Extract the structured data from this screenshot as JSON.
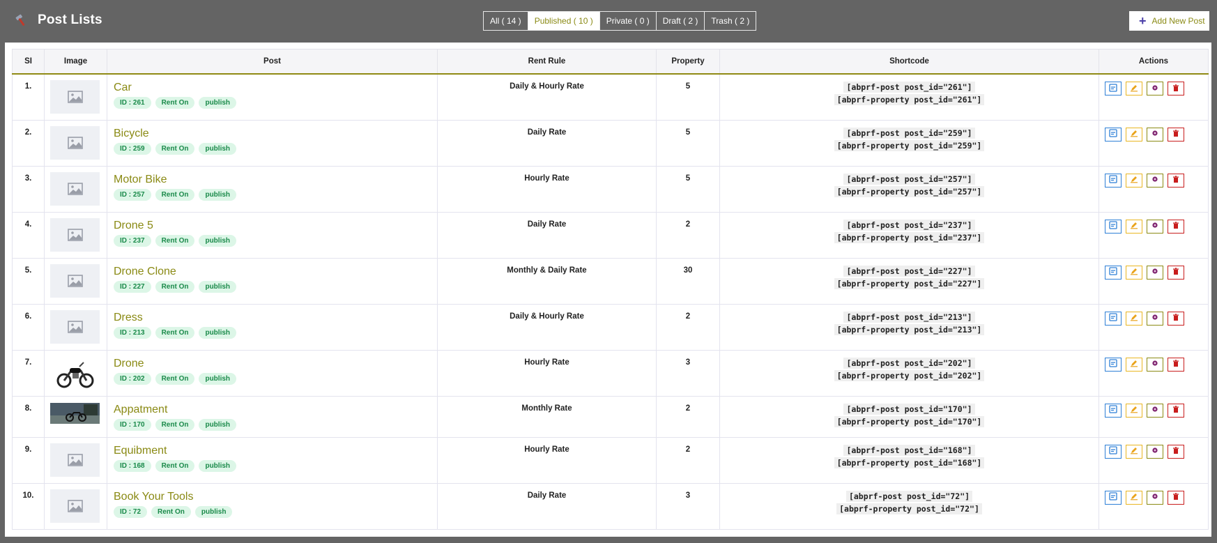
{
  "header": {
    "title": "Post Lists",
    "filters": [
      {
        "label": "All ( 14 )",
        "active": false
      },
      {
        "label": "Published ( 10 )",
        "active": true
      },
      {
        "label": "Private ( 0 )",
        "active": false
      },
      {
        "label": "Draft ( 2 )",
        "active": false
      },
      {
        "label": "Trash ( 2 )",
        "active": false
      }
    ],
    "add_label": "Add New Post"
  },
  "table": {
    "columns": [
      "SI",
      "Image",
      "Post",
      "Rent Rule",
      "Property",
      "Shortcode",
      "Actions"
    ],
    "rows": [
      {
        "si": "1.",
        "image": "placeholder",
        "title": "Car",
        "id_tag": "ID : 261",
        "rent_tag": "Rent On",
        "status_tag": "publish",
        "rule": "Daily & Hourly Rate",
        "property": "5",
        "sc1": "[abprf-post post_id=\"261\"]",
        "sc2": "[abprf-property post_id=\"261\"]"
      },
      {
        "si": "2.",
        "image": "placeholder",
        "title": "Bicycle",
        "id_tag": "ID : 259",
        "rent_tag": "Rent On",
        "status_tag": "publish",
        "rule": "Daily Rate",
        "property": "5",
        "sc1": "[abprf-post post_id=\"259\"]",
        "sc2": "[abprf-property post_id=\"259\"]"
      },
      {
        "si": "3.",
        "image": "placeholder",
        "title": "Motor Bike",
        "id_tag": "ID : 257",
        "rent_tag": "Rent On",
        "status_tag": "publish",
        "rule": "Hourly Rate",
        "property": "5",
        "sc1": "[abprf-post post_id=\"257\"]",
        "sc2": "[abprf-property post_id=\"257\"]"
      },
      {
        "si": "4.",
        "image": "placeholder",
        "title": "Drone 5",
        "id_tag": "ID : 237",
        "rent_tag": "Rent On",
        "status_tag": "publish",
        "rule": "Daily Rate",
        "property": "2",
        "sc1": "[abprf-post post_id=\"237\"]",
        "sc2": "[abprf-property post_id=\"237\"]"
      },
      {
        "si": "5.",
        "image": "placeholder",
        "title": "Drone Clone",
        "id_tag": "ID : 227",
        "rent_tag": "Rent On",
        "status_tag": "publish",
        "rule": "Monthly & Daily Rate",
        "property": "30",
        "sc1": "[abprf-post post_id=\"227\"]",
        "sc2": "[abprf-property post_id=\"227\"]"
      },
      {
        "si": "6.",
        "image": "placeholder",
        "title": "Dress",
        "id_tag": "ID : 213",
        "rent_tag": "Rent On",
        "status_tag": "publish",
        "rule": "Daily & Hourly Rate",
        "property": "2",
        "sc1": "[abprf-post post_id=\"213\"]",
        "sc2": "[abprf-property post_id=\"213\"]"
      },
      {
        "si": "7.",
        "image": "motorbike-photo",
        "title": "Drone",
        "id_tag": "ID : 202",
        "rent_tag": "Rent On",
        "status_tag": "publish",
        "rule": "Hourly Rate",
        "property": "3",
        "sc1": "[abprf-post post_id=\"202\"]",
        "sc2": "[abprf-property post_id=\"202\"]"
      },
      {
        "si": "8.",
        "image": "motorbike-landscape-photo",
        "title": "Appatment",
        "id_tag": "ID : 170",
        "rent_tag": "Rent On",
        "status_tag": "publish",
        "rule": "Monthly Rate",
        "property": "2",
        "sc1": "[abprf-post post_id=\"170\"]",
        "sc2": "[abprf-property post_id=\"170\"]"
      },
      {
        "si": "9.",
        "image": "placeholder",
        "title": "Equibment",
        "id_tag": "ID : 168",
        "rent_tag": "Rent On",
        "status_tag": "publish",
        "rule": "Hourly Rate",
        "property": "2",
        "sc1": "[abprf-post post_id=\"168\"]",
        "sc2": "[abprf-property post_id=\"168\"]"
      },
      {
        "si": "10.",
        "image": "placeholder",
        "title": "Book Your Tools",
        "id_tag": "ID : 72",
        "rent_tag": "Rent On",
        "status_tag": "publish",
        "rule": "Daily Rate",
        "property": "3",
        "sc1": "[abprf-post post_id=\"72\"]",
        "sc2": "[abprf-property post_id=\"72\"]"
      }
    ]
  },
  "icons": {
    "brand": "hammer-icon",
    "add": "plus-icon",
    "actions": [
      "view-icon",
      "edit-icon",
      "preview-icon",
      "trash-icon"
    ]
  },
  "colors": {
    "background": "#646464",
    "accent": "#8a8a14",
    "tag_bg": "#dcf6e7",
    "tag_text": "#1a8a4a",
    "view": "#2d7fd6",
    "edit": "#e9b622",
    "delete": "#c81d1d"
  }
}
